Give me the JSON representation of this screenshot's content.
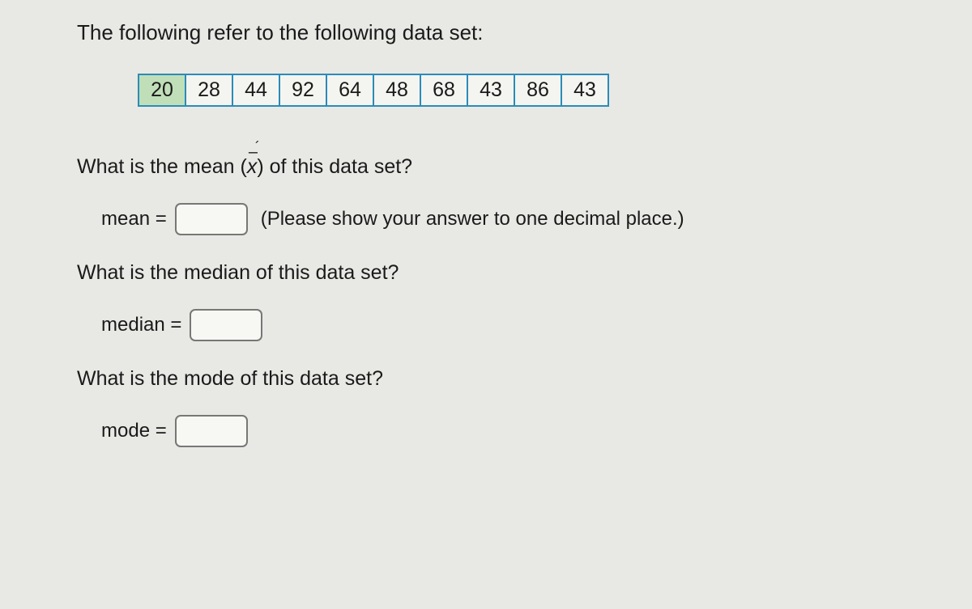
{
  "intro": "The following refer to the following data set:",
  "data": [
    "20",
    "28",
    "44",
    "92",
    "64",
    "48",
    "68",
    "43",
    "86",
    "43"
  ],
  "highlightedIndex": 0,
  "q_mean_prefix": "What is the mean (",
  "q_mean_symbol": "x",
  "q_mean_suffix": ") of this data set?",
  "mean_label": "mean =",
  "mean_hint": "(Please show your answer to one decimal place.)",
  "q_median": "What is the median of this data set?",
  "median_label": "median =",
  "q_mode": "What is the mode of this data set?",
  "mode_label": "mode ="
}
